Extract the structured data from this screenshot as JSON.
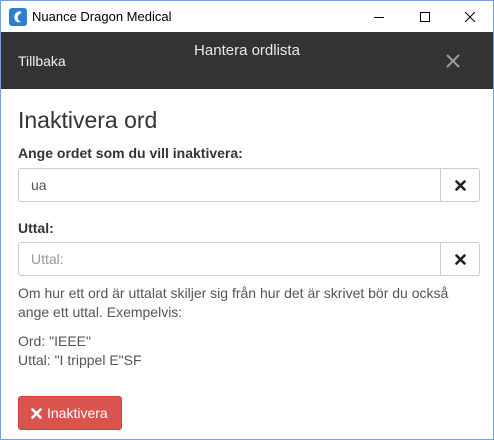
{
  "window": {
    "title": "Nuance Dragon Medical",
    "icon": "dragon-app-icon",
    "controls": [
      "minimize-icon",
      "maximize-icon",
      "close-icon"
    ]
  },
  "header": {
    "back_label": "Tillbaka",
    "title": "Hantera ordlista",
    "close_icon": "close-icon"
  },
  "form": {
    "page_title": "Inaktivera ord",
    "word_label": "Ange ordet som du vill inaktivera:",
    "word_value": "ua",
    "pronunciation_label": "Uttal:",
    "pronunciation_value": "",
    "pronunciation_placeholder": "Uttal:",
    "help_text": "Om hur ett ord är uttalat skiljer sig från hur det är skrivet bör du också ange ett uttal. Exempelvis:",
    "example_word": "Ord: \"IEEE\"",
    "example_pronunciation": "Uttal: \"I trippel E\"SF",
    "submit_label": "Inaktivera"
  },
  "colors": {
    "header_bg": "#333333",
    "danger": "#d9534f",
    "accent": "#2f7fd0"
  }
}
